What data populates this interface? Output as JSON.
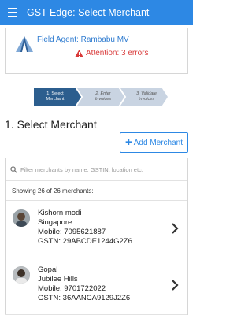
{
  "appbar": {
    "title": "GST Edge: Select Merchant",
    "menu_icon": "hamburger-menu-icon",
    "color": "#2d88e4"
  },
  "agent": {
    "label": "Field Agent: Rambabu MV",
    "attention": "Attention: 3 errors",
    "logo_icon": "company-logo-icon",
    "warning_icon": "warning-triangle-icon"
  },
  "steps": [
    {
      "line1": "1. Select",
      "line2": "Merchant",
      "state": "active"
    },
    {
      "line1": "2. Enter",
      "line2": "Invoices",
      "state": "inactive"
    },
    {
      "line1": "3. Validate",
      "line2": "Invoices",
      "state": "inactive"
    }
  ],
  "section": {
    "title": "1. Select Merchant"
  },
  "add_button": {
    "label": "Add Merchant",
    "icon": "plus-icon"
  },
  "search": {
    "placeholder": "Filter merchants by name, GSTIN, location etc.",
    "value": ""
  },
  "list": {
    "count_text": "Showing 26 of 26 merchants:",
    "merchants": [
      {
        "name": "Kishorn modi",
        "location": "Singapore",
        "mobile": "Mobile: 7095621887",
        "gstn": "GSTN: 29ABCDE1244G2Z6"
      },
      {
        "name": "Gopal",
        "location": "Jubilee Hills",
        "mobile": "Mobile: 9701722022",
        "gstn": "GSTN: 36AANCA9129J2Z6"
      }
    ]
  },
  "colors": {
    "accent": "#2d88e4",
    "step_active": "#2c5e8e",
    "step_inactive": "#c9d4e2",
    "error": "#d93a3a"
  }
}
